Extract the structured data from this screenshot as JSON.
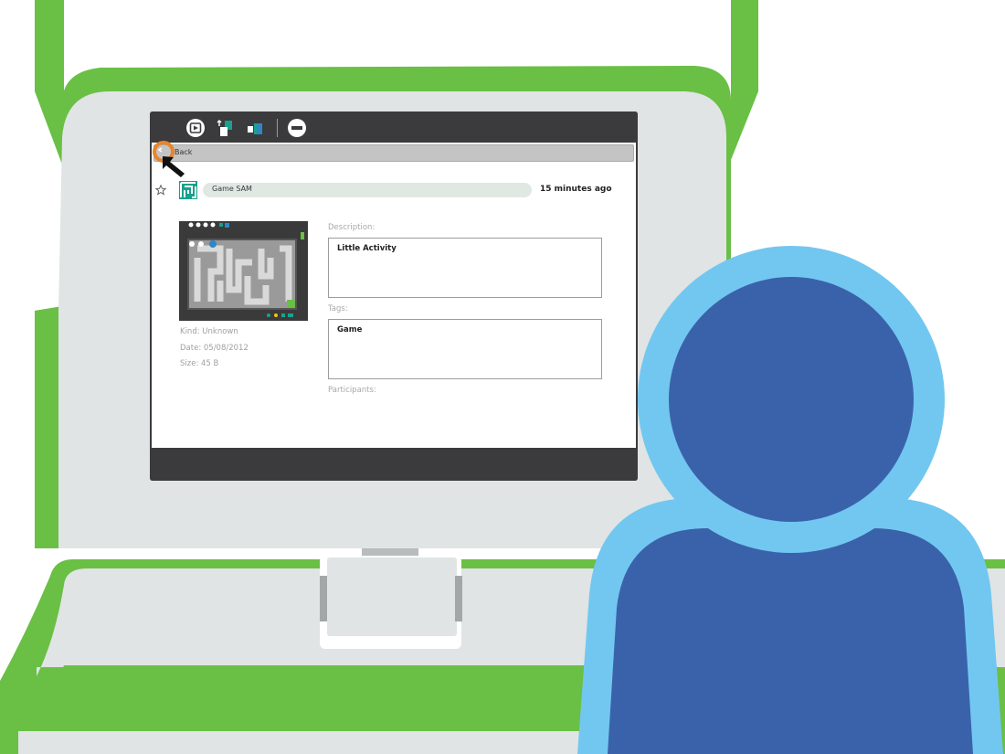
{
  "journal": {
    "toolbar": {
      "resume_icon": "play-icon",
      "copy_icon": "copy-to-icon",
      "duplicate_icon": "duplicate-icon",
      "erase_icon": "remove-icon"
    },
    "back_label": "Back",
    "entry": {
      "title": "Game SAM",
      "time": "15 minutes ago",
      "kind": "Kind: Unknown",
      "date": "Date: 05/08/2012",
      "size": "Size: 45 B",
      "description_label": "Description:",
      "description_value": "Little Activity",
      "tags_label": "Tags:",
      "tags_value": "Game",
      "participants_label": "Participants:"
    }
  },
  "colors": {
    "laptop_green": "#6abf45",
    "laptop_gray": "#e0e4e4",
    "screen_frame": "#3b3a3c",
    "person_outline": "#72c7f0",
    "person_fill": "#3a62aa",
    "cursor_ring": "#e8852a",
    "activity_icon": "#1aa08d"
  }
}
